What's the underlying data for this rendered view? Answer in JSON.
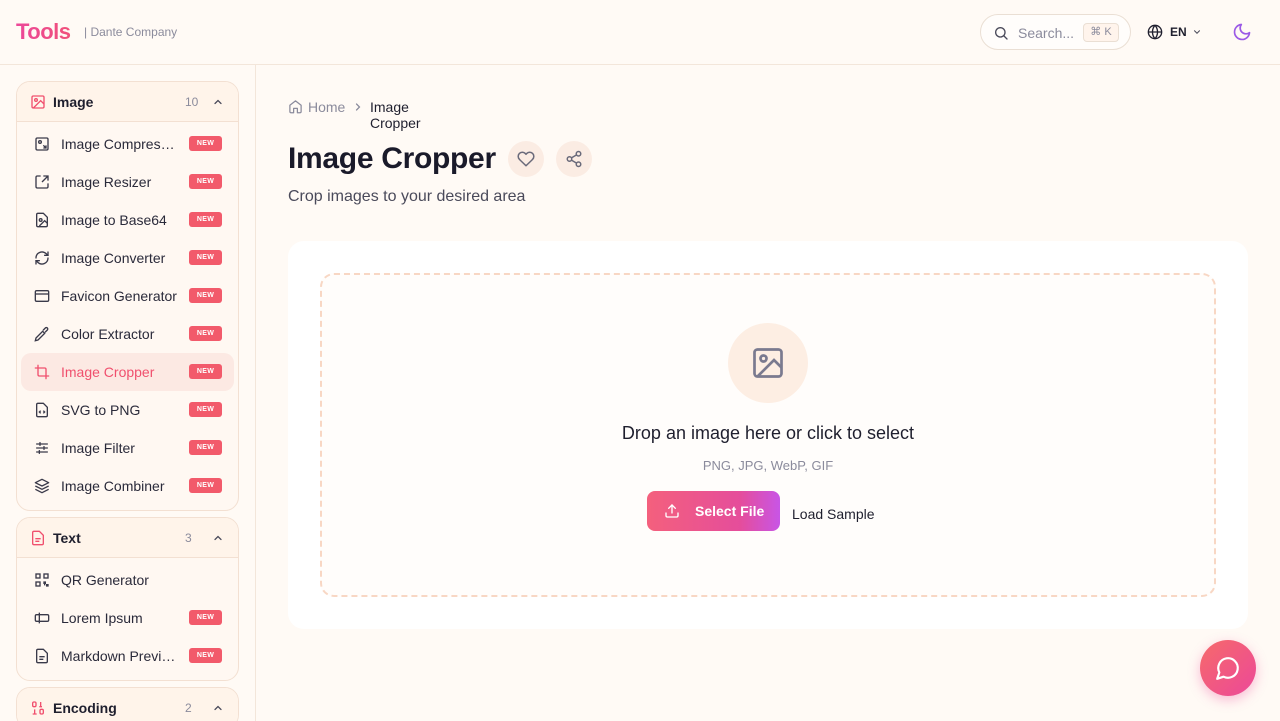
{
  "header": {
    "logo": "Tools",
    "company": "| Dante Company",
    "search": {
      "placeholder": "Search...",
      "shortcut": "⌘ K"
    },
    "language": "EN"
  },
  "sidebar": {
    "groups": [
      {
        "title": "Image",
        "count": "10",
        "items": [
          {
            "label": "Image Compressor",
            "badge": "NEW",
            "icon": "image-compress-icon"
          },
          {
            "label": "Image Resizer",
            "badge": "NEW",
            "icon": "resize-icon"
          },
          {
            "label": "Image to Base64",
            "badge": "NEW",
            "icon": "file-image-icon"
          },
          {
            "label": "Image Converter",
            "badge": "NEW",
            "icon": "refresh-icon"
          },
          {
            "label": "Favicon Generator",
            "badge": "NEW",
            "icon": "browser-window-icon"
          },
          {
            "label": "Color Extractor",
            "badge": "NEW",
            "icon": "eyedropper-icon"
          },
          {
            "label": "Image Cropper",
            "badge": "NEW",
            "icon": "crop-icon",
            "active": true
          },
          {
            "label": "SVG to PNG",
            "badge": "NEW",
            "icon": "file-code-icon"
          },
          {
            "label": "Image Filter",
            "badge": "NEW",
            "icon": "sliders-icon"
          },
          {
            "label": "Image Combiner",
            "badge": "NEW",
            "icon": "layers-icon"
          }
        ]
      },
      {
        "title": "Text",
        "count": "3",
        "items": [
          {
            "label": "QR Generator",
            "badge": "",
            "icon": "qr-code-icon"
          },
          {
            "label": "Lorem Ipsum",
            "badge": "NEW",
            "icon": "text-cursor-icon"
          },
          {
            "label": "Markdown Preview",
            "badge": "NEW",
            "icon": "file-text-icon"
          }
        ]
      },
      {
        "title": "Encoding",
        "count": "2",
        "items": []
      }
    ]
  },
  "breadcrumb": {
    "home": "Home",
    "current": "Image Cropper"
  },
  "page": {
    "title": "Image Cropper",
    "subtitle": "Crop images to your desired area"
  },
  "dropzone": {
    "title": "Drop an image here or click to select",
    "formats": "PNG, JPG, WebP, GIF",
    "select_button": "Select File",
    "load_sample": "Load Sample"
  },
  "colors": {
    "accent": "#f0506e",
    "badge": "#f25a6b",
    "background": "#fffaf5"
  }
}
